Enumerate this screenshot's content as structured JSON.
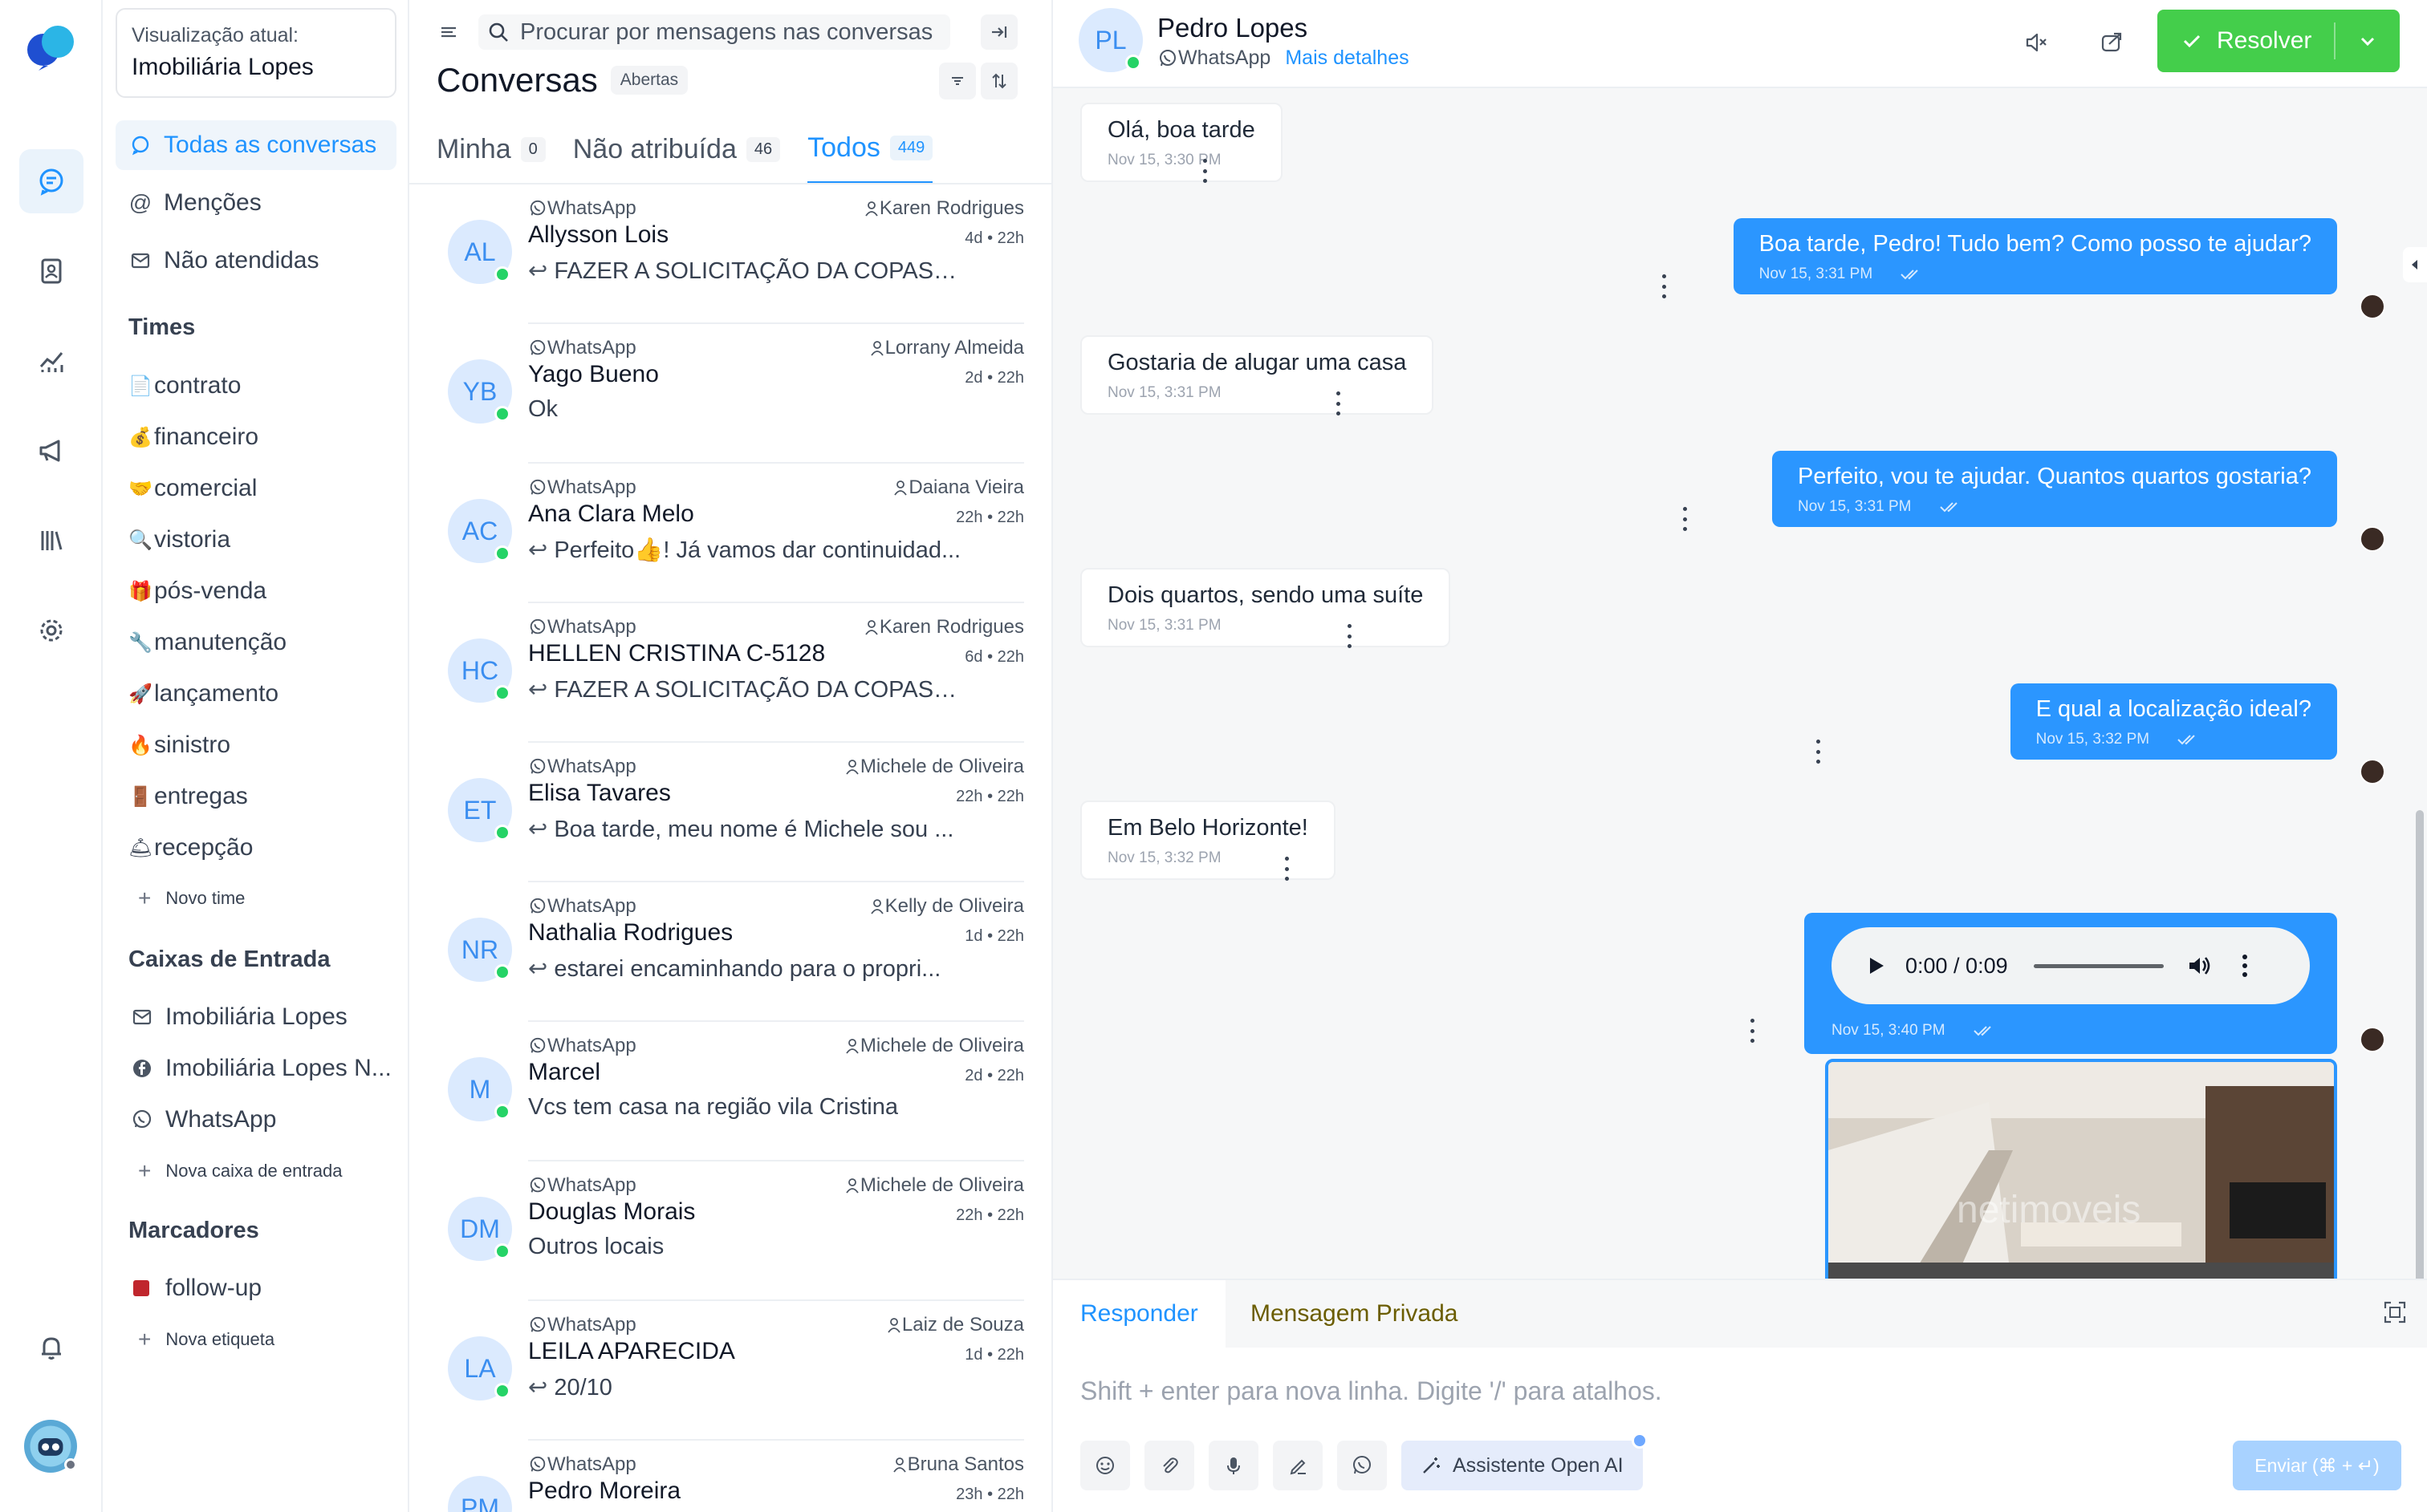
{
  "colors": {
    "accent": "#1f93ff",
    "resolve_green": "#44ce4b",
    "outgoing_bubble": "#2b96ff",
    "whatsapp_green": "#25d366",
    "label_red": "#c0262d"
  },
  "rail": {
    "items": [
      {
        "icon": "chat-bubble-icon",
        "active": true
      },
      {
        "icon": "contacts-book-icon",
        "active": false
      },
      {
        "icon": "reports-chart-icon",
        "active": false
      },
      {
        "icon": "megaphone-icon",
        "active": false
      },
      {
        "icon": "library-icon",
        "active": false
      },
      {
        "icon": "gear-icon",
        "active": false
      }
    ]
  },
  "sidebar": {
    "account_caption": "Visualização atual:",
    "account_name": "Imobiliária Lopes",
    "nav": [
      {
        "label": "Todas as conversas",
        "icon": "chat-bubble-icon",
        "active": true
      },
      {
        "label": "Menções",
        "icon": "at-sign-icon",
        "active": false
      },
      {
        "label": "Não atendidas",
        "icon": "envelope-icon",
        "active": false
      }
    ],
    "teams_heading": "Times",
    "teams": [
      {
        "emoji": "📄",
        "label": "contrato"
      },
      {
        "emoji": "💰",
        "label": "financeiro"
      },
      {
        "emoji": "🤝",
        "label": "comercial"
      },
      {
        "emoji": "🔍",
        "label": "vistoria"
      },
      {
        "emoji": "🎁",
        "label": "pós-venda"
      },
      {
        "emoji": "🔧",
        "label": "manutenção"
      },
      {
        "emoji": "🚀",
        "label": "lançamento"
      },
      {
        "emoji": "🔥",
        "label": "sinistro"
      },
      {
        "emoji": "🚪",
        "label": "entregas"
      },
      {
        "emoji": "🛎",
        "label": "recepção"
      }
    ],
    "new_team": "Novo time",
    "inboxes_heading": "Caixas de Entrada",
    "inboxes": [
      {
        "icon": "envelope-icon",
        "label": "Imobiliária Lopes"
      },
      {
        "icon": "facebook-icon",
        "label": "Imobiliária Lopes N..."
      },
      {
        "icon": "whatsapp-icon",
        "label": "WhatsApp"
      }
    ],
    "new_inbox": "Nova caixa de entrada",
    "labels_heading": "Marcadores",
    "labels": [
      {
        "label": "follow-up",
        "color": "#c0262d"
      }
    ],
    "new_label": "Nova etiqueta"
  },
  "list": {
    "search_placeholder": "Procurar por mensagens nas conversas",
    "title": "Conversas",
    "status": "Abertas",
    "tabs": [
      {
        "label": "Minha",
        "count": "0",
        "active": false
      },
      {
        "label": "Não atribuída",
        "count": "46",
        "active": false
      },
      {
        "label": "Todos",
        "count": "449",
        "active": true
      }
    ],
    "conversations": [
      {
        "initials": "AL",
        "source": "WhatsApp",
        "agent": "Karen Rodrigues",
        "name": "Allysson Lois",
        "time": "4d • 22h",
        "message": "FAZER A SOLICITAÇÃO DA COPASA ...",
        "reply": true
      },
      {
        "initials": "YB",
        "source": "WhatsApp",
        "agent": "Lorrany Almeida",
        "name": "Yago Bueno",
        "time": "2d • 22h",
        "message": "Ok",
        "reply": false
      },
      {
        "initials": "AC",
        "source": "WhatsApp",
        "agent": "Daiana Vieira",
        "name": "Ana Clara Melo",
        "time": "22h • 22h",
        "message": "Perfeito👍! Já vamos dar continuidad...",
        "reply": true
      },
      {
        "initials": "HC",
        "source": "WhatsApp",
        "agent": "Karen Rodrigues",
        "name": "HELLEN CRISTINA C-5128",
        "time": "6d • 22h",
        "message": "FAZER A SOLICITAÇÃO DA COPASA ...",
        "reply": true
      },
      {
        "initials": "ET",
        "source": "WhatsApp",
        "agent": "Michele de Oliveira",
        "name": "Elisa Tavares",
        "time": "22h • 22h",
        "message": "Boa tarde, meu nome é Michele sou ...",
        "reply": true
      },
      {
        "initials": "NR",
        "source": "WhatsApp",
        "agent": "Kelly de Oliveira",
        "name": "Nathalia Rodrigues",
        "time": "1d • 22h",
        "message": "estarei encaminhando para o propri...",
        "reply": true
      },
      {
        "initials": "M",
        "source": "WhatsApp",
        "agent": "Michele de Oliveira",
        "name": "Marcel",
        "time": "2d • 22h",
        "message": "Vcs tem casa na região vila Cristina",
        "reply": false
      },
      {
        "initials": "DM",
        "source": "WhatsApp",
        "agent": "Michele de Oliveira",
        "name": "Douglas Morais",
        "time": "22h • 22h",
        "message": "Outros locais",
        "reply": false
      },
      {
        "initials": "LA",
        "source": "WhatsApp",
        "agent": "Laiz de Souza",
        "name": "LEILA APARECIDA",
        "time": "1d • 22h",
        "message": "20/10",
        "reply": true
      },
      {
        "initials": "PM",
        "source": "WhatsApp",
        "agent": "Bruna Santos",
        "name": "Pedro Moreira",
        "time": "23h • 22h",
        "message": "",
        "reply": false
      }
    ]
  },
  "chat": {
    "initials": "PL",
    "name": "Pedro Lopes",
    "channel": "WhatsApp",
    "more_details": "Mais detalhes",
    "resolve": "Resolver",
    "messages": [
      {
        "dir": "in",
        "text": "Olá, boa tarde",
        "time": "Nov 15, 3:30 PM"
      },
      {
        "dir": "out",
        "text": "Boa tarde, Pedro! Tudo bem? Como posso te ajudar?",
        "time": "Nov 15, 3:31 PM"
      },
      {
        "dir": "in",
        "text": "Gostaria de alugar uma casa",
        "time": "Nov 15, 3:31 PM"
      },
      {
        "dir": "out",
        "text": "Perfeito, vou te ajudar. Quantos quartos gostaria?",
        "time": "Nov 15, 3:31 PM"
      },
      {
        "dir": "in",
        "text": "Dois quartos, sendo uma suíte",
        "time": "Nov 15, 3:31 PM"
      },
      {
        "dir": "out",
        "text": "E qual a localização ideal?",
        "time": "Nov 15, 3:32 PM"
      },
      {
        "dir": "in",
        "text": "Em Belo Horizonte!",
        "time": "Nov 15, 3:32 PM"
      }
    ],
    "audio": {
      "time": "0:00 / 0:09",
      "timestamp": "Nov 15, 3:40 PM"
    },
    "image_watermark": "netimoveis",
    "composer": {
      "tab_reply": "Responder",
      "tab_private": "Mensagem Privada",
      "placeholder": "Shift + enter para nova linha. Digite '/' para atalhos.",
      "ai_button": "Assistente Open AI",
      "send": "Enviar (⌘ + ↵)"
    }
  }
}
